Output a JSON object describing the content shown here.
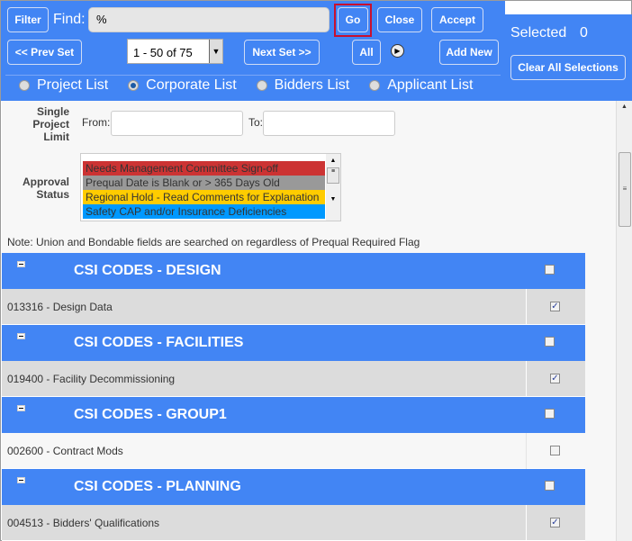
{
  "toolbar": {
    "filter": "Filter",
    "find_label": "Find:",
    "find_value": "%",
    "go": "Go",
    "close": "Close",
    "accept": "Accept",
    "prev_set": "<< Prev Set",
    "pager": "1 - 50 of 75",
    "next_set": "Next Set >>",
    "all": "All",
    "add_new": "Add New"
  },
  "list_types": [
    {
      "label": "Project List",
      "selected": false
    },
    {
      "label": "Corporate List",
      "selected": true
    },
    {
      "label": "Bidders List",
      "selected": false
    },
    {
      "label": "Applicant List",
      "selected": false
    }
  ],
  "selection": {
    "label": "Selected",
    "count": "0",
    "clear": "Clear All Selections"
  },
  "filters": {
    "limit_label_1": "Single",
    "limit_label_2": "Project",
    "limit_label_3": "Limit",
    "from": "From:",
    "to": "To:",
    "approval_1": "Approval",
    "approval_2": "Status",
    "statuses": [
      {
        "label": "Needs Management Committee Sign-off",
        "color": "#cc3333"
      },
      {
        "label": "Prequal Date is Blank or > 365 Days Old",
        "color": "#999999"
      },
      {
        "label": "Regional Hold - Read Comments for Explanation",
        "color": "#ffcc00"
      },
      {
        "label": "Safety CAP and/or Insurance Deficiencies",
        "color": "#0099ff"
      }
    ],
    "note": "Note: Union and Bondable fields are searched on regardless of Prequal Required Flag"
  },
  "groups": [
    {
      "title": "CSI CODES - DESIGN",
      "item": "013316 - Design Data",
      "checked": true
    },
    {
      "title": "CSI CODES - FACILITIES",
      "item": "019400 - Facility Decommissioning",
      "checked": true
    },
    {
      "title": "CSI CODES - GROUP1",
      "item": "002600 - Contract Mods",
      "checked": false
    },
    {
      "title": "CSI CODES - PLANNING",
      "item": "004513 - Bidders' Qualifications",
      "checked": true
    }
  ],
  "colors": {
    "accent": "#4285f4",
    "row_gray": "#dcdcdc"
  }
}
